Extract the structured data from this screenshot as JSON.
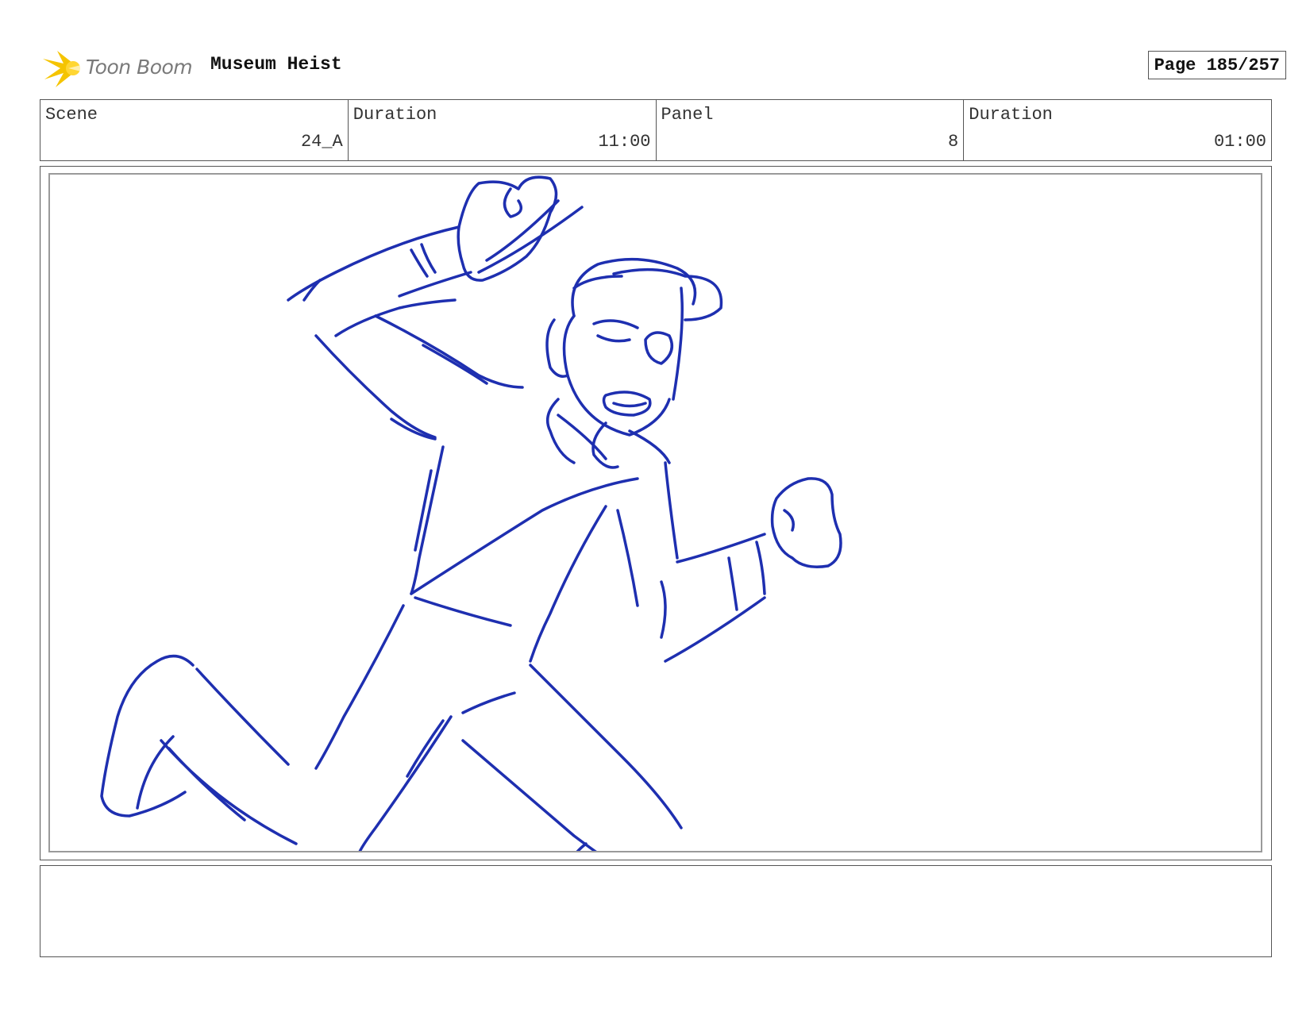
{
  "logo": {
    "text": "Toon Boom",
    "icon": "starburst-logo-icon"
  },
  "project": {
    "title": "Museum Heist"
  },
  "page": {
    "label": "Page 185/257"
  },
  "info": [
    {
      "label": "Scene",
      "value": "24_A"
    },
    {
      "label": "Duration",
      "value": "11:00"
    },
    {
      "label": "Panel",
      "value": "8"
    },
    {
      "label": "Duration",
      "value": "01:00"
    }
  ],
  "panel": {
    "sketch": "blue-pencil-character-sketch",
    "stroke_color": "#1e2fb0"
  },
  "notes": {
    "text": ""
  },
  "colors": {
    "logo_yellow": "#f5c400",
    "logo_text": "#7a7a7a",
    "border": "#555555",
    "inner_frame": "#9a9a9a"
  }
}
